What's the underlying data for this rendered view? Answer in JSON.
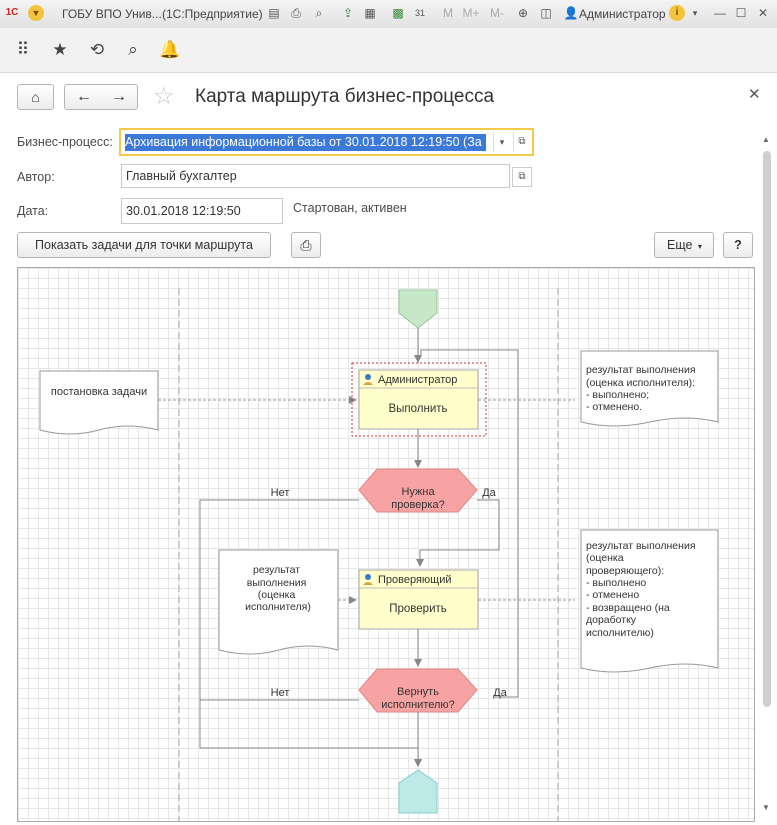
{
  "window": {
    "title": "ГОБУ ВПО Унив...",
    "app": "(1С:Предприятие)",
    "user": "Администратор",
    "toolbar_icons": [
      "save-icon",
      "print-icon",
      "preview-icon",
      "export-icon",
      "table-icon",
      "calculator-icon",
      "calendar-icon",
      "m-icon",
      "mplus-icon",
      "mminus-icon",
      "zoom-icon",
      "panel-icon"
    ],
    "m": "M",
    "mplus": "M+",
    "mminus": "M-"
  },
  "form": {
    "title": "Карта маршрута бизнес-процесса",
    "process_label": "Бизнес-процесс:",
    "process_value": "Архивация информационной базы от 30.01.2018 12:19:50 (За",
    "author_label": "Автор:",
    "author_value": "Главный бухгалтер",
    "date_label": "Дата:",
    "date_value": "30.01.2018 12:19:50",
    "status": "Стартован, активен",
    "show_tasks_button": "Показать задачи для точки маршрута",
    "more_button": "Еще",
    "help_button": "?"
  },
  "map": {
    "note_task": "постановка задачи",
    "admin_header": "Администратор",
    "admin_action": "Выполнить",
    "cond1_line1": "Нужна",
    "cond1_line2": "проверка?",
    "no1": "Нет",
    "yes1": "Да",
    "note_right1": [
      "результат выполнения",
      "(оценка исполнителя):",
      "- выполнено;",
      "- отменено."
    ],
    "note_left2": [
      "результат",
      "выполнения",
      "(оценка",
      "исполнителя)"
    ],
    "checker_header": "Проверяющий",
    "checker_action": "Проверить",
    "note_right2": [
      "результат выполнения",
      "(оценка",
      "проверяющего):",
      "- выполнено",
      "- отменено",
      "- возвращено (на",
      "доработку",
      "исполнителю)"
    ],
    "cond2_line1": "Вернуть",
    "cond2_line2": "исполнителю?",
    "no2": "Нет",
    "yes2": "Да",
    "colors": {
      "start": "#c6e8c6",
      "end": "#bdeae6",
      "task": "#ffffcc",
      "condition": "#f7a3a3",
      "focus": "#f2c94c"
    }
  }
}
